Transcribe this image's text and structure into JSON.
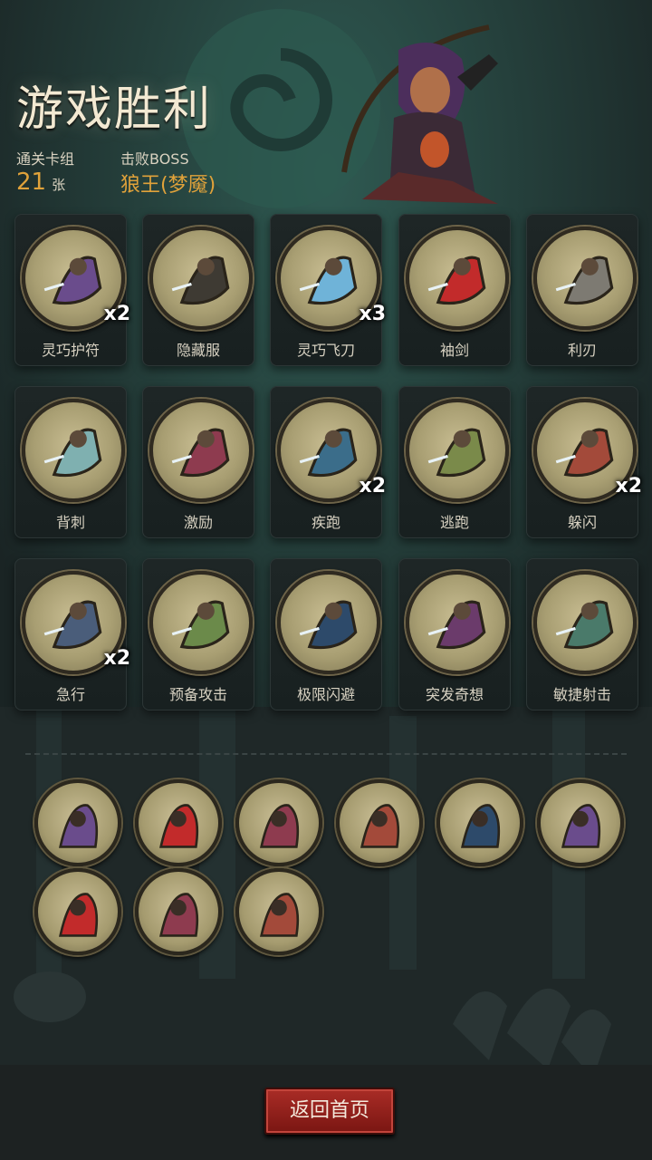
{
  "title": "游戏胜利",
  "stats": {
    "deck_label": "通关卡组",
    "deck_count": "21",
    "deck_unit": "张",
    "boss_label": "击败BOSS",
    "boss_name": "狼王(梦魇)"
  },
  "cards": [
    {
      "name": "灵巧护符",
      "count": "x2",
      "icon": "amulet-icon"
    },
    {
      "name": "隐藏服",
      "count": "",
      "icon": "hood-icon"
    },
    {
      "name": "灵巧飞刀",
      "count": "x3",
      "icon": "flying-knives-icon"
    },
    {
      "name": "袖剑",
      "count": "",
      "icon": "sleeve-blade-icon"
    },
    {
      "name": "利刃",
      "count": "",
      "icon": "dagger-icon"
    },
    {
      "name": "背刺",
      "count": "",
      "icon": "backstab-icon"
    },
    {
      "name": "激励",
      "count": "",
      "icon": "inspire-icon"
    },
    {
      "name": "疾跑",
      "count": "x2",
      "icon": "sprint-icon"
    },
    {
      "name": "逃跑",
      "count": "",
      "icon": "flee-icon"
    },
    {
      "name": "躲闪",
      "count": "x2",
      "icon": "dodge-icon"
    },
    {
      "name": "急行",
      "count": "x2",
      "icon": "hurry-icon"
    },
    {
      "name": "预备攻击",
      "count": "",
      "icon": "ready-attack-icon"
    },
    {
      "name": "极限闪避",
      "count": "",
      "icon": "extreme-evade-icon"
    },
    {
      "name": "突发奇想",
      "count": "",
      "icon": "idea-icon"
    },
    {
      "name": "敏捷射击",
      "count": "",
      "icon": "agile-shot-icon"
    }
  ],
  "relics": [
    {
      "icon": "hooded-lightning-icon"
    },
    {
      "icon": "cheese-helmet-icon"
    },
    {
      "icon": "archer-girl-icon"
    },
    {
      "icon": "bleeding-fist-icon"
    },
    {
      "icon": "magic-hand-icon"
    },
    {
      "icon": "vampire-icon"
    },
    {
      "icon": "red-assassin-icon"
    },
    {
      "icon": "card-hand-icon"
    },
    {
      "icon": "bleeding-fist-icon"
    }
  ],
  "footer": {
    "home_button": "返回首页"
  },
  "colors": {
    "accent": "#e0a23a",
    "button": "#a92c26",
    "background": "#1b2525"
  }
}
